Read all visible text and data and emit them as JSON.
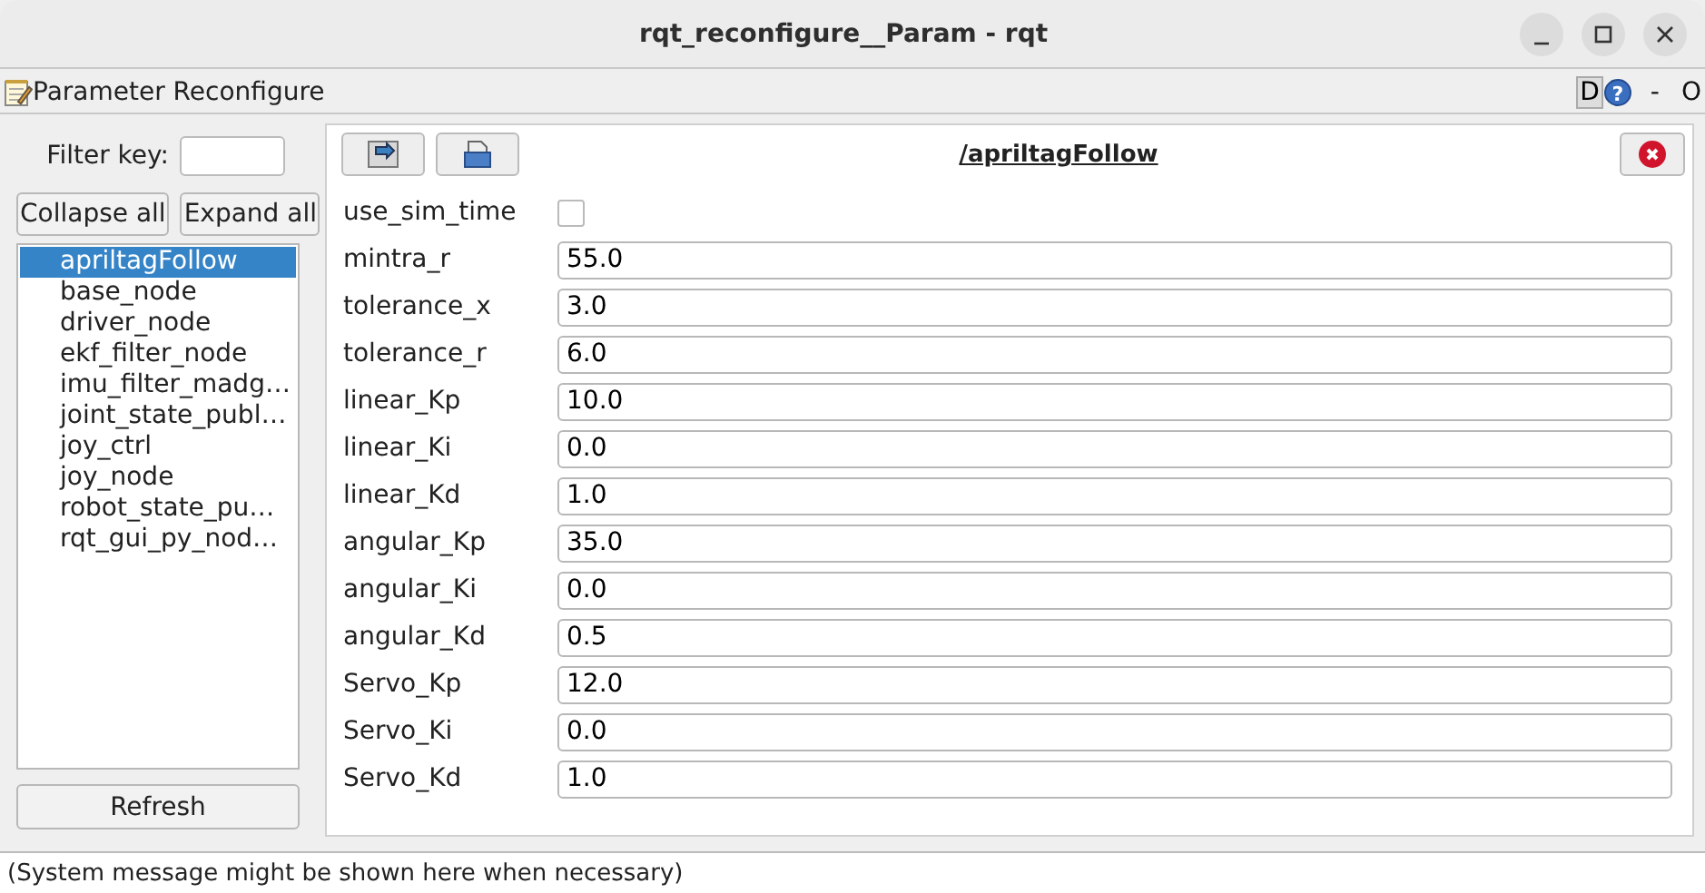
{
  "window": {
    "title": "rqt_reconfigure__Param - rqt"
  },
  "plugin": {
    "title": "Parameter Reconfigure",
    "d_label": "D",
    "help_label": "?",
    "dash": "-",
    "o_label": "O"
  },
  "filter": {
    "label": "Filter key:"
  },
  "buttons": {
    "collapse": "Collapse all",
    "expand": "Expand all",
    "refresh": "Refresh"
  },
  "nodes": [
    {
      "label": "apriltagFollow",
      "selected": true
    },
    {
      "label": "base_node",
      "selected": false
    },
    {
      "label": "driver_node",
      "selected": false
    },
    {
      "label": "ekf_filter_node",
      "selected": false
    },
    {
      "label": "imu_filter_madg…",
      "selected": false
    },
    {
      "label": "joint_state_publ…",
      "selected": false
    },
    {
      "label": "joy_ctrl",
      "selected": false
    },
    {
      "label": "joy_node",
      "selected": false
    },
    {
      "label": "robot_state_pu…",
      "selected": false
    },
    {
      "label": "rqt_gui_py_nod…",
      "selected": false
    }
  ],
  "editor": {
    "title": "/apriltagFollow"
  },
  "params": [
    {
      "kind": "checkbox",
      "name": "use_sim_time",
      "checked": false
    },
    {
      "kind": "text",
      "name": "mintra_r",
      "value": "55.0"
    },
    {
      "kind": "text",
      "name": "tolerance_x",
      "value": "3.0"
    },
    {
      "kind": "text",
      "name": "tolerance_r",
      "value": "6.0"
    },
    {
      "kind": "text",
      "name": "linear_Kp",
      "value": "10.0"
    },
    {
      "kind": "text",
      "name": "linear_Ki",
      "value": "0.0"
    },
    {
      "kind": "text",
      "name": "linear_Kd",
      "value": "1.0"
    },
    {
      "kind": "text",
      "name": "angular_Kp",
      "value": "35.0"
    },
    {
      "kind": "text",
      "name": "angular_Ki",
      "value": "0.0"
    },
    {
      "kind": "text",
      "name": "angular_Kd",
      "value": "0.5"
    },
    {
      "kind": "text",
      "name": "Servo_Kp",
      "value": "12.0"
    },
    {
      "kind": "text",
      "name": "Servo_Ki",
      "value": "0.0"
    },
    {
      "kind": "text",
      "name": "Servo_Kd",
      "value": "1.0"
    }
  ],
  "status_bar": {
    "message": "(System message might be shown here when necessary)"
  }
}
